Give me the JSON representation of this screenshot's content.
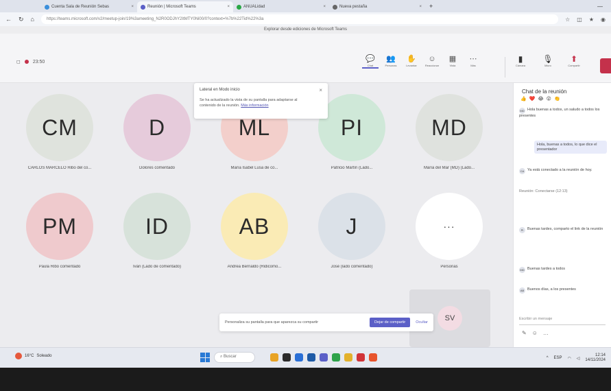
{
  "browser": {
    "tabs": [
      {
        "label": "Cuenta Sala de Reunión Sebas",
        "color": "#3b8fdb",
        "active": false
      },
      {
        "label": "Reunión | Microsoft Teams",
        "color": "#5b5fc7",
        "active": true
      },
      {
        "label": "ANUALidad",
        "color": "#29a745",
        "active": false
      },
      {
        "label": "Nueva pestaña",
        "color": "#666666",
        "active": false
      }
    ],
    "url": "https://teams.microsoft.com/v2/meetup-join/19%3ameeting_N2R0ODJhY2ItMTY0Ni00/0?context=%7b%22Tid%22%3a",
    "info_text": "Explorar desde ediciones de Microsoft Teams"
  },
  "meeting": {
    "timer": "23:50"
  },
  "toolbar": {
    "tools": [
      {
        "icon": "chat-icon",
        "glyph": "💬",
        "label": "Chat",
        "active": true
      },
      {
        "icon": "people-icon",
        "glyph": "👥",
        "label": "Personas",
        "active": false
      },
      {
        "icon": "raise-hand-icon",
        "glyph": "✋",
        "label": "Levantar",
        "active": false
      },
      {
        "icon": "react-icon",
        "glyph": "☺",
        "label": "Reaccionar",
        "active": false
      },
      {
        "icon": "view-icon",
        "glyph": "▦",
        "label": "Vista",
        "active": false
      },
      {
        "icon": "more-icon",
        "glyph": "⋯",
        "label": "Más",
        "active": false
      }
    ],
    "controls": [
      {
        "icon": "camera-icon",
        "glyph": "▮",
        "label": "Cámara"
      },
      {
        "icon": "mic-icon",
        "glyph": "🎙",
        "label": "Micro"
      },
      {
        "icon": "share-icon",
        "glyph": "⬆",
        "label": "Compartir"
      }
    ]
  },
  "participants": [
    {
      "initials": "CM",
      "name": "CARLOS MARCELO Ribo del co...",
      "color": "#dfe3dd"
    },
    {
      "initials": "D",
      "name": "Dolores comentado",
      "color": "#e6cbdb"
    },
    {
      "initials": "ML",
      "name": "María Isabel Lusa de co...",
      "color": "#f3cfcb"
    },
    {
      "initials": "PI",
      "name": "Patricio Martín (Lado...",
      "color": "#cfe8d8"
    },
    {
      "initials": "MD",
      "name": "María del Mar (MD) (Lado...",
      "color": "#dfe2de"
    },
    {
      "initials": "PM",
      "name": "Paula Ribo comentado",
      "color": "#efcacd"
    },
    {
      "initials": "ID",
      "name": "Iván (Lado de comentado)",
      "color": "#d7e2da"
    },
    {
      "initials": "AB",
      "name": "Andrea Bernaldo (Ridicomo...",
      "color": "#faebb5"
    },
    {
      "initials": "J",
      "name": "José (lado comentado)",
      "color": "#dbe1e8"
    },
    {
      "initials": "···",
      "name": "Personas",
      "color": "#ffffff"
    }
  ],
  "self_view": {
    "initials": "SV"
  },
  "notice": {
    "title": "Lateral en Modo inicio",
    "line1": "Se ha actualizado la vista de su pantalla para adaptarse al",
    "line2": "contenido de la reunión.",
    "link": "Más información"
  },
  "share_prompt": {
    "text": "Personaliza su pantalla para que aparezca su compartir",
    "button": "Dejar de compartir",
    "dismiss": "Ocultar"
  },
  "chat": {
    "title": "Chat de la reunión",
    "reactions": [
      "👍",
      "❤️",
      "😂",
      "😮",
      "👏"
    ],
    "messages": [
      {
        "avatar": "MD",
        "text": "Hola buenas a todos, un saludo a todos los presentes"
      },
      {
        "avatar": "",
        "text": "Hola, buenas a todos, lo que dice el presentador"
      },
      {
        "avatar": "CA",
        "text": "Ya está conectado a la reunión de hoy."
      },
      {
        "avatar": "",
        "text": "Reunión: Conectarse (12:13)"
      },
      {
        "avatar": "PI",
        "text": "Buenas tardes, comparto el link de la reunión"
      },
      {
        "avatar": "MD",
        "text": "Buenas tardes a todos"
      },
      {
        "avatar": "AB",
        "text": "Buenos días, a los presentes"
      }
    ],
    "input_placeholder": "Escribir un mensaje",
    "tools": [
      "✎",
      "☺",
      "…"
    ]
  },
  "taskbar": {
    "temperature": "16°C",
    "weather": "Soleado",
    "search": "Buscar",
    "apps": [
      "#e8a325",
      "#2b2b2b",
      "#2a6fd6",
      "#1e5aa6",
      "#5b5fc7",
      "#2fa34b",
      "#e3b12c",
      "#d13438",
      "#e8542c"
    ],
    "time": "12:14",
    "date": "14/11/2024",
    "lang": "ESP"
  }
}
